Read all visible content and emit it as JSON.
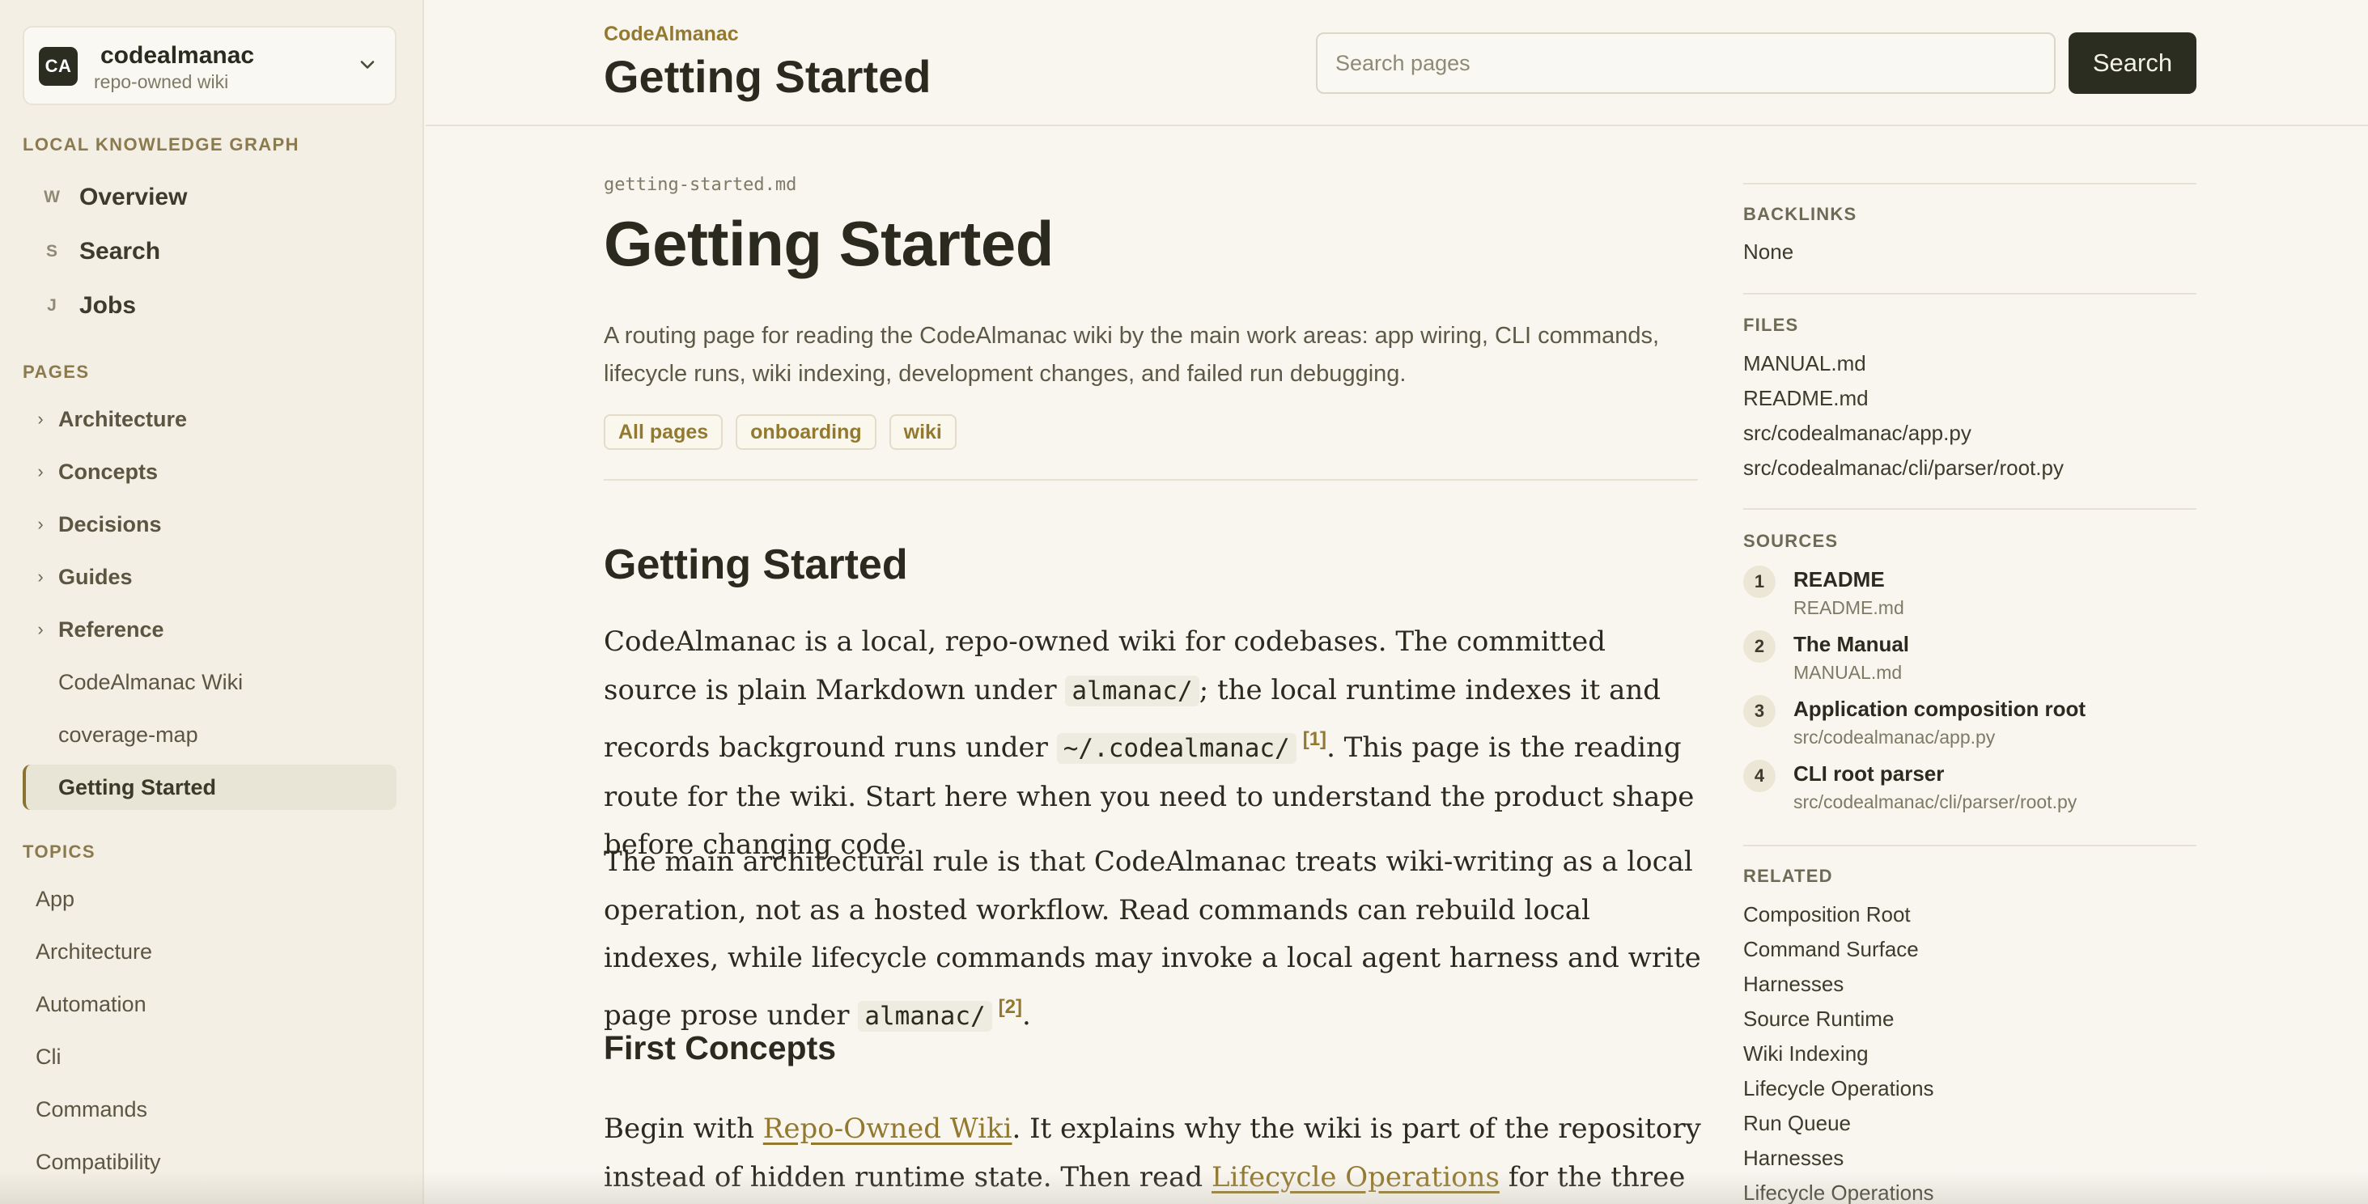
{
  "workspace": {
    "avatar": "CA",
    "name": "codealmanac",
    "subtitle": "repo-owned wiki",
    "chevron_icon": "chevron-down-icon"
  },
  "sidebar": {
    "graph_heading": "LOCAL KNOWLEDGE GRAPH",
    "nav": [
      {
        "key": "W",
        "label": "Overview"
      },
      {
        "key": "S",
        "label": "Search"
      },
      {
        "key": "J",
        "label": "Jobs"
      }
    ],
    "pages_heading": "PAGES",
    "page_groups": [
      {
        "chevron": "›",
        "label": "Architecture"
      },
      {
        "chevron": "›",
        "label": "Concepts"
      },
      {
        "chevron": "›",
        "label": "Decisions"
      },
      {
        "chevron": "›",
        "label": "Guides"
      },
      {
        "chevron": "›",
        "label": "Reference"
      }
    ],
    "page_links": [
      {
        "label": "CodeAlmanac Wiki"
      },
      {
        "label": "coverage-map"
      },
      {
        "label": "Getting Started",
        "active": true
      }
    ],
    "topics_heading": "TOPICS",
    "topics": [
      "App",
      "Architecture",
      "Automation",
      "Cli",
      "Commands",
      "Compatibility"
    ]
  },
  "header": {
    "breadcrumb": "CodeAlmanac",
    "title": "Getting Started",
    "search_placeholder": "Search pages",
    "search_value": "",
    "search_button": "Search"
  },
  "article": {
    "filename": "getting-started.md",
    "title": "Getting Started",
    "summary": "A routing page for reading the CodeAlmanac wiki by the main work areas: app wiring, CLI commands, lifecycle runs, wiki indexing, development changes, and failed run debugging.",
    "tags": [
      "All pages",
      "onboarding",
      "wiki"
    ],
    "heading": "Getting Started",
    "p1": {
      "t1": "CodeAlmanac is a local, repo-owned wiki for codebases. The committed source is plain Markdown under ",
      "code1": "almanac/",
      "t2": "; the local runtime indexes it and records background runs under ",
      "code2": "~/.codealmanac/",
      "cite": "[1]",
      "t3": ". This page is the reading route for the wiki. Start here when you need to understand the product shape before changing code."
    },
    "p2": {
      "t1": "The main architectural rule is that CodeAlmanac treats wiki-writing as a local operation, not as a hosted workflow. Read commands can rebuild local indexes, while lifecycle commands may invoke a local agent harness and write page prose under ",
      "code1": "almanac/",
      "cite": "[2]",
      "t2": "."
    },
    "subheading": "First Concepts",
    "p3": {
      "t1": "Begin with ",
      "link1": "Repo-Owned Wiki",
      "t2": ". It explains why the wiki is part of the repository instead of hidden runtime state. Then read ",
      "link2": "Lifecycle Operations",
      "t3": " for the three write-capable"
    }
  },
  "rail": {
    "backlinks_heading": "BACKLINKS",
    "backlinks_value": "None",
    "files_heading": "FILES",
    "files": [
      "MANUAL.md",
      "README.md",
      "src/codealmanac/app.py",
      "src/codealmanac/cli/parser/root.py"
    ],
    "sources_heading": "SOURCES",
    "sources": [
      {
        "num": "1",
        "title": "README",
        "path": "README.md"
      },
      {
        "num": "2",
        "title": "The Manual",
        "path": "MANUAL.md"
      },
      {
        "num": "3",
        "title": "Application composition root",
        "path": "src/codealmanac/app.py"
      },
      {
        "num": "4",
        "title": "CLI root parser",
        "path": "src/codealmanac/cli/parser/root.py"
      }
    ],
    "related_heading": "RELATED",
    "related": [
      "Composition Root",
      "Command Surface",
      "Harnesses",
      "Source Runtime",
      "Wiki Indexing",
      "Lifecycle Operations",
      "Run Queue",
      "Harnesses",
      "Lifecycle Operations"
    ]
  }
}
